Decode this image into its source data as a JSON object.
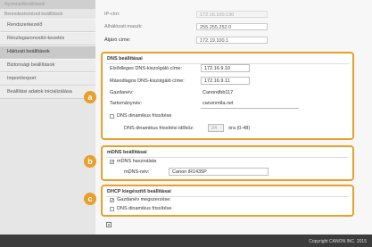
{
  "sidebar": {
    "top_label": "Nyomtatóbeállítások",
    "heading": "Berendezésnézeti beállítások",
    "items": [
      {
        "label": "Rendszerkezelő"
      },
      {
        "label": "Részlegazonosító-kezelés"
      },
      {
        "label": "Hálózati beállítások"
      },
      {
        "label": "Biztonsági beállítások"
      },
      {
        "label": "Import/export"
      },
      {
        "label": "Beállítási adatok inicializálása"
      }
    ]
  },
  "top_fields": {
    "ip_label": "IP-cím:",
    "ip_value": "172.16.100.130",
    "mask_label": "Alhálózati maszk:",
    "mask_value": "255.255.252.0",
    "gateway_label": "Átjáró címe:",
    "gateway_value": "172.19.100.1"
  },
  "dns": {
    "title": "DNS beállításai",
    "primary_label": "Elsődleges DNS-kiszolgáló címe:",
    "primary_value": "172.16.9.10",
    "secondary_label": "Másodlagos DNS-kiszolgáló címe:",
    "secondary_value": "172.16.9.11",
    "host_label": "Gazdanév:",
    "host_value": "Canondbb117",
    "domain_label": "Tartománynév:",
    "domain_value": "canonmtla.net",
    "dyn_update_label": "DNS dinamikus frissítése",
    "interval_label": "DNS dinamikus frissítési időköz:",
    "interval_value": "24",
    "interval_unit": "óra (0-48)"
  },
  "mdns": {
    "title": "mDNS beállításai",
    "use_label": "mDNS használata",
    "name_label": "mDNS-név:",
    "name_value": "Canon iR1435P"
  },
  "dhcp": {
    "title": "DHCP kiegészítő beállításai",
    "hostname_label": "Gazdanév megszerzése:",
    "dyn_update_label": "DNS dinamikus frissítése"
  },
  "badges": {
    "a": "a",
    "b": "b",
    "c": "c"
  },
  "footer": {
    "copyright": "Copyright CANON INC. 2015"
  },
  "colors": {
    "accent": "#e8a02a",
    "footer": "#3c3c3c"
  }
}
